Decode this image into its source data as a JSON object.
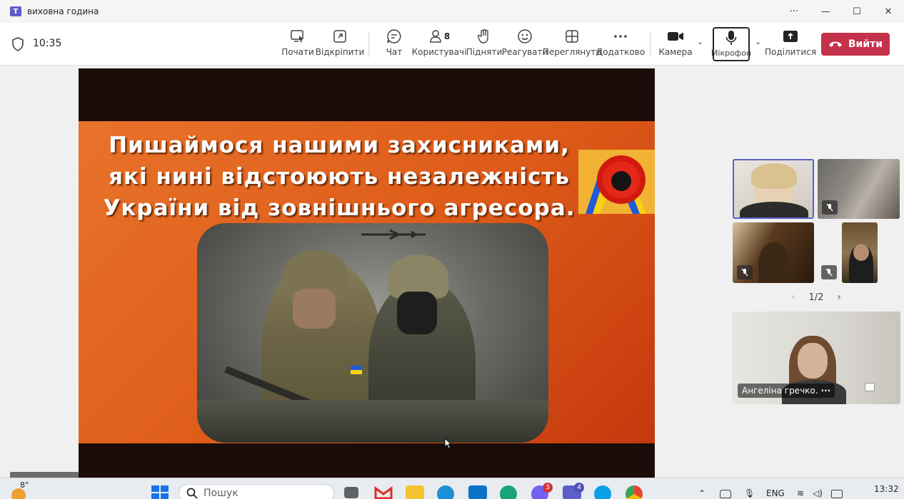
{
  "window": {
    "title": "виховна година",
    "more_label": "···",
    "minimize_label": "—",
    "maximize_label": "☐",
    "close_label": "✕"
  },
  "meeting": {
    "time": "10:35"
  },
  "toolbar": {
    "start_label": "Почати",
    "popout_label": "Відкріпити",
    "chat_label": "Чат",
    "people_label": "Користувачі",
    "people_count": "8",
    "raise_label": "Підняти",
    "react_label": "Реагувати",
    "view_label": "Переглянути",
    "more_label": "Додатково",
    "camera_label": "Камера",
    "mic_label": "Мікрофон",
    "share_label": "Поділитися",
    "leave_label": "Вийти"
  },
  "slide": {
    "line1": "Пишаймося нашими захисниками,",
    "line2": "які нині відстоюють незалежність",
    "line3": "України від  зовнішнього агресора."
  },
  "gallery": {
    "page": "1/2",
    "prev_label": "‹",
    "next_label": "›"
  },
  "featured": {
    "name": "Ангеліна гречко.",
    "more": "···"
  },
  "taskbar": {
    "weather_temp": "8°",
    "search_placeholder": "Пошук",
    "teams_badge": "4",
    "viber_badge": "3",
    "lang": "ENG",
    "time": "13:32"
  },
  "colors": {
    "accent": "#5b5fc7",
    "leave": "#c4314b"
  }
}
